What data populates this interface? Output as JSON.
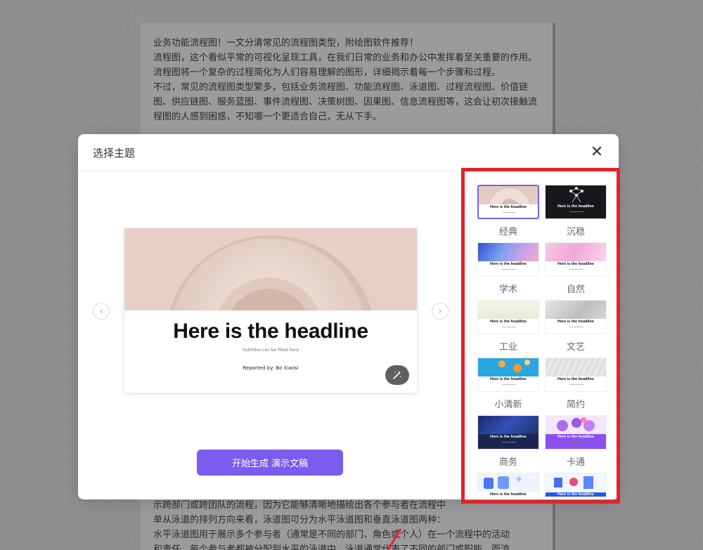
{
  "document": {
    "paragraphs": [
      "业务功能流程图！一文分清常见的流程图类型，附绘图软件推荐！",
      "流程图，这个看似平常的可视化呈现工具，在我们日常的业务和办公中发挥着至关重要的作用。流程图将一个复杂的过程简化为人们容易理解的图形，详细揭示着每一个步骤和过程。",
      "不过，常见的流程图类型繁多，包括业务流程图、功能流程图、泳道图、过程流程图、价值链图、供应链图、服务蓝图、事件流程图、决策树图、因果图、信息流程图等，这会让初次接触流程图的人感到困惑，不知哪一个更适合自己，无从下手。"
    ],
    "bottom_lines": [
      "示跨部门或跨团队的流程，因为它能够清晰地描绘出各个参与者在流程中",
      "单从泳道的排列方向来看，泳道图可分为水平泳道图和垂直泳道图两种：",
      "水平泳道图用于展示多个参与者（通常是不同的部门、角色或个人）在一个流程中的活动",
      "和责任。每个参与者都被分配到水平的泳道中，泳道通常代表了不同的部门或职能，而流"
    ]
  },
  "modal": {
    "title": "选择主题",
    "close_icon": "close-icon",
    "slide": {
      "headline": "Here is the headline",
      "subtitle": "Subtitles can be filled here",
      "reporter": "Reported by:  Bo Xiaosi"
    },
    "generate_label": "开始生成 演示文稿",
    "themes": [
      {
        "label": "经典",
        "thumb_text": "Here is the headline",
        "selected": true
      },
      {
        "label": "沉稳",
        "thumb_text": "Here is the headline",
        "selected": false
      },
      {
        "label": "学术",
        "thumb_text": "Here is the headline",
        "selected": false
      },
      {
        "label": "自然",
        "thumb_text": "Here is the headline",
        "selected": false
      },
      {
        "label": "工业",
        "thumb_text": "Here is the headline",
        "selected": false
      },
      {
        "label": "文艺",
        "thumb_text": "Here is the headline",
        "selected": false
      },
      {
        "label": "小清新",
        "thumb_text": "Here is the headline",
        "selected": false
      },
      {
        "label": "简约",
        "thumb_text": "Here is the headline",
        "selected": false
      },
      {
        "label": "商务",
        "thumb_text": "Here is the headline",
        "selected": false
      },
      {
        "label": "卡通",
        "thumb_text": "Here is the headline",
        "selected": false
      },
      {
        "label": "",
        "thumb_text": "Here is the headline",
        "selected": false
      },
      {
        "label": "",
        "thumb_text": "Here is the headline",
        "selected": false
      }
    ]
  },
  "colors": {
    "accent": "#7a5cf0",
    "highlight_frame": "#e4222c"
  }
}
